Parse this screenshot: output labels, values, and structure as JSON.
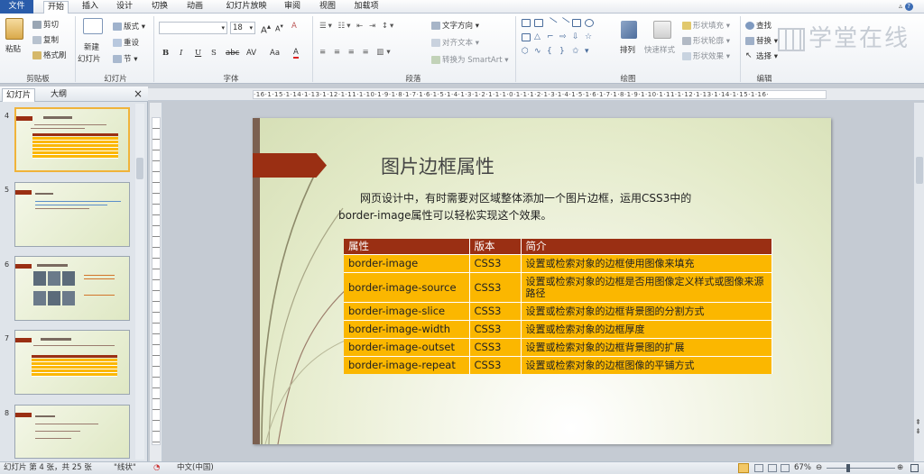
{
  "tabs": [
    "文件",
    "开始",
    "插入",
    "设计",
    "切换",
    "动画",
    "幻灯片放映",
    "审阅",
    "视图",
    "加载项"
  ],
  "active_tab": "开始",
  "ribbon": {
    "clipboard": {
      "paste": "粘贴",
      "cut": "剪切",
      "copy": "复制",
      "format_painter": "格式刷",
      "label": "剪贴板"
    },
    "slides": {
      "new_slide": "新建",
      "new_slide2": "幻灯片",
      "layout": "版式",
      "reset": "重设",
      "section": "节",
      "label": "幻灯片"
    },
    "font": {
      "name": "",
      "size": "18",
      "label": "字体",
      "bold": "B",
      "italic": "I",
      "underline": "U",
      "strike": "S",
      "shadow": "abc",
      "spacing": "AV",
      "case": "Aa",
      "color": "A",
      "grow": "A",
      "shrink": "A",
      "clear": "A"
    },
    "paragraph": {
      "text_direction": "文字方向",
      "align_text": "对齐文本",
      "smartart": "转换为 SmartArt",
      "label": "段落"
    },
    "drawing": {
      "arrange": "排列",
      "quick_styles": "快速样式",
      "shape_fill": "形状填充",
      "shape_outline": "形状轮廓",
      "shape_effects": "形状效果",
      "label": "绘图"
    },
    "editing": {
      "find": "查找",
      "replace": "替换",
      "select": "选择",
      "label": "编辑"
    }
  },
  "watermark": "学堂在线",
  "panel": {
    "tab_slides": "幻灯片",
    "tab_outline": "大纲",
    "close": "×"
  },
  "thumbnails": [
    {
      "num": "4",
      "selected": true
    },
    {
      "num": "5",
      "selected": false
    },
    {
      "num": "6",
      "selected": false
    },
    {
      "num": "7",
      "selected": false
    },
    {
      "num": "8",
      "selected": false
    }
  ],
  "ruler_text": "·16·1·15·1·14·1·13·1·12·1·11·1·10·1·9·1·8·1·7·1·6·1·5·1·4·1·3·1·2·1·1·1·0·1·1·1·2·1·3·1·4·1·5·1·6·1·7·1·8·1·9·1·10·1·11·1·12·1·13·1·14·1·15·1·16·",
  "slide": {
    "title": "图片边框属性",
    "body_line1": "网页设计中，有时需要对区域整体添加一个图片边框，运用CSS3中的",
    "body_line2": "border-image属性可以轻松实现这个效果。",
    "table": {
      "headers": [
        "属性",
        "版本",
        "简介"
      ],
      "rows": [
        [
          "border-image",
          "CSS3",
          "设置或检索对象的边框使用图像来填充"
        ],
        [
          "border-image-source",
          "CSS3",
          "设置或检索对象的边框是否用图像定义样式或图像来源路径"
        ],
        [
          "border-image-slice",
          "CSS3",
          "设置或检索对象的边框背景图的分割方式"
        ],
        [
          "border-image-width",
          "CSS3",
          "设置或检索对象的边框厚度"
        ],
        [
          "border-image-outset",
          "CSS3",
          "设置或检索对象的边框背景图的扩展"
        ],
        [
          "border-image-repeat",
          "CSS3",
          "设置或检索对象的边框图像的平铺方式"
        ]
      ]
    }
  },
  "status": {
    "slide_info": "幻灯片 第 4 张，共 25 张",
    "theme": "\"线状\"",
    "language": "中文(中国)",
    "zoom": "67%"
  },
  "colors": {
    "accent": "#9a2f13",
    "table_row": "#fbb700",
    "file_tab": "#2a5caa"
  }
}
